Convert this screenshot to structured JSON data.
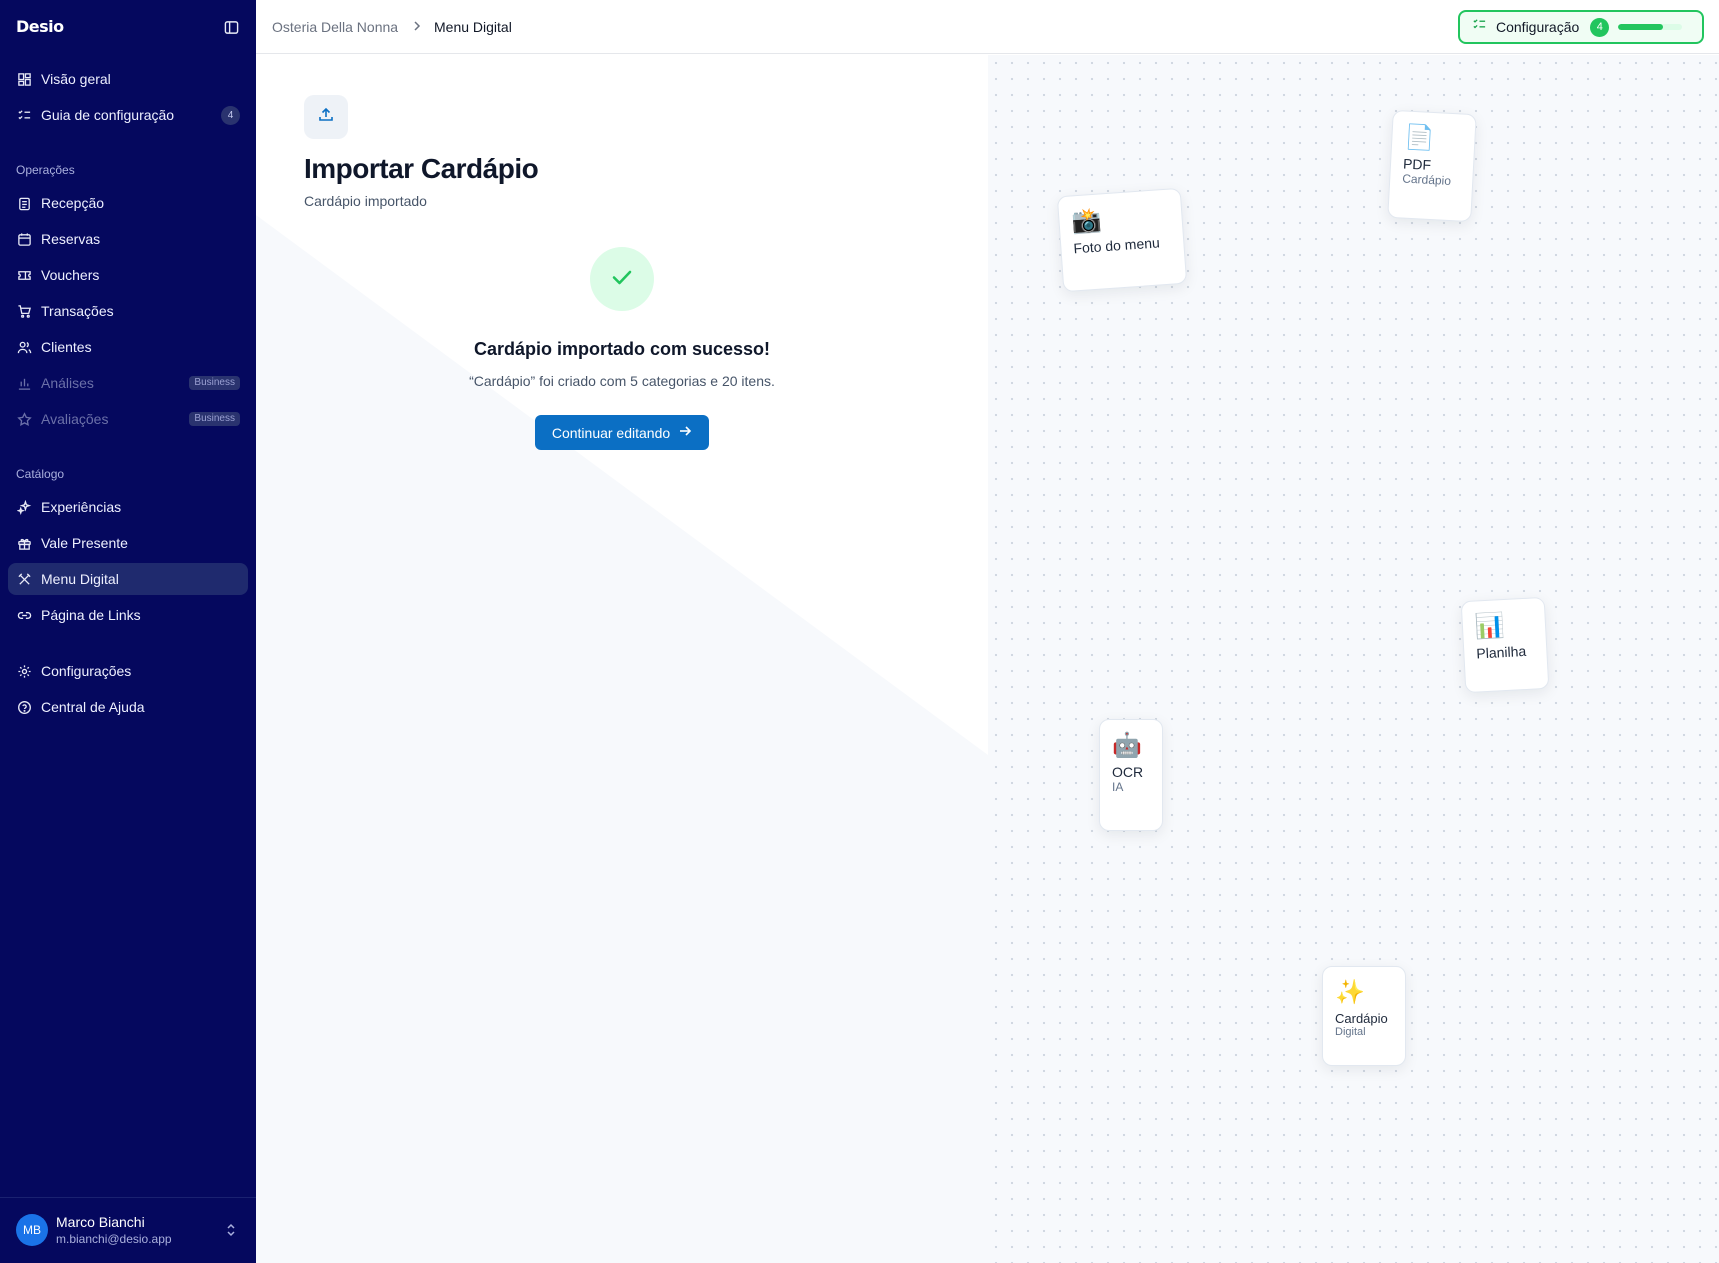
{
  "app": {
    "logo": "Desio"
  },
  "sidebar": {
    "top_items": [
      {
        "label": "Visão geral",
        "icon": "dashboard-icon"
      },
      {
        "label": "Guia de configuração",
        "icon": "checklist-icon",
        "badge": "4"
      }
    ],
    "groups": [
      {
        "label": "Operações",
        "items": [
          {
            "label": "Recepção",
            "icon": "clipboard-icon"
          },
          {
            "label": "Reservas",
            "icon": "calendar-icon"
          },
          {
            "label": "Vouchers",
            "icon": "ticket-icon"
          },
          {
            "label": "Transações",
            "icon": "cart-icon"
          },
          {
            "label": "Clientes",
            "icon": "users-icon"
          },
          {
            "label": "Análises",
            "icon": "bar-chart-icon",
            "plan": "Business"
          },
          {
            "label": "Avaliações",
            "icon": "star-icon",
            "plan": "Business"
          }
        ]
      },
      {
        "label": "Catálogo",
        "items": [
          {
            "label": "Experiências",
            "icon": "sparkles-icon"
          },
          {
            "label": "Vale Presente",
            "icon": "gift-icon"
          },
          {
            "label": "Menu Digital",
            "icon": "utensils-icon",
            "active": true
          },
          {
            "label": "Página de Links",
            "icon": "link-icon"
          }
        ]
      }
    ],
    "bottom_items": [
      {
        "label": "Configurações",
        "icon": "gear-icon"
      },
      {
        "label": "Central de Ajuda",
        "icon": "help-circle-icon"
      }
    ],
    "user": {
      "initials": "MB",
      "name": "Marco Bianchi",
      "email": "m.bianchi@desio.app"
    }
  },
  "topbar": {
    "breadcrumb": [
      "Osteria Della Nonna",
      "Menu Digital"
    ],
    "setup": {
      "label": "Configuração",
      "count": "4",
      "progress": 0.7
    }
  },
  "main": {
    "title": "Importar Cardápio",
    "subtitle": "Cardápio importado",
    "success_title": "Cardápio importado com sucesso!",
    "success_desc": "“Cardápio” foi criado com 5 categorias e 20 itens.",
    "continue_label": "Continuar editando"
  },
  "illustration": {
    "cards": [
      {
        "key": "photo",
        "emoji": "📸",
        "title": "Foto do menu",
        "sub": ""
      },
      {
        "key": "pdf",
        "emoji": "📄",
        "title": "PDF",
        "sub": "Cardápio"
      },
      {
        "key": "sheet",
        "emoji": "📊",
        "title": "Planilha",
        "sub": ""
      },
      {
        "key": "ocr",
        "emoji": "🤖",
        "title": "OCR",
        "sub": "IA"
      },
      {
        "key": "digital",
        "emoji": "✨",
        "title": "Cardápio",
        "sub": "Digital"
      }
    ]
  },
  "colors": {
    "sidebar_bg": "#05085e",
    "accent": "#0b6fc4",
    "success": "#22c55e"
  }
}
